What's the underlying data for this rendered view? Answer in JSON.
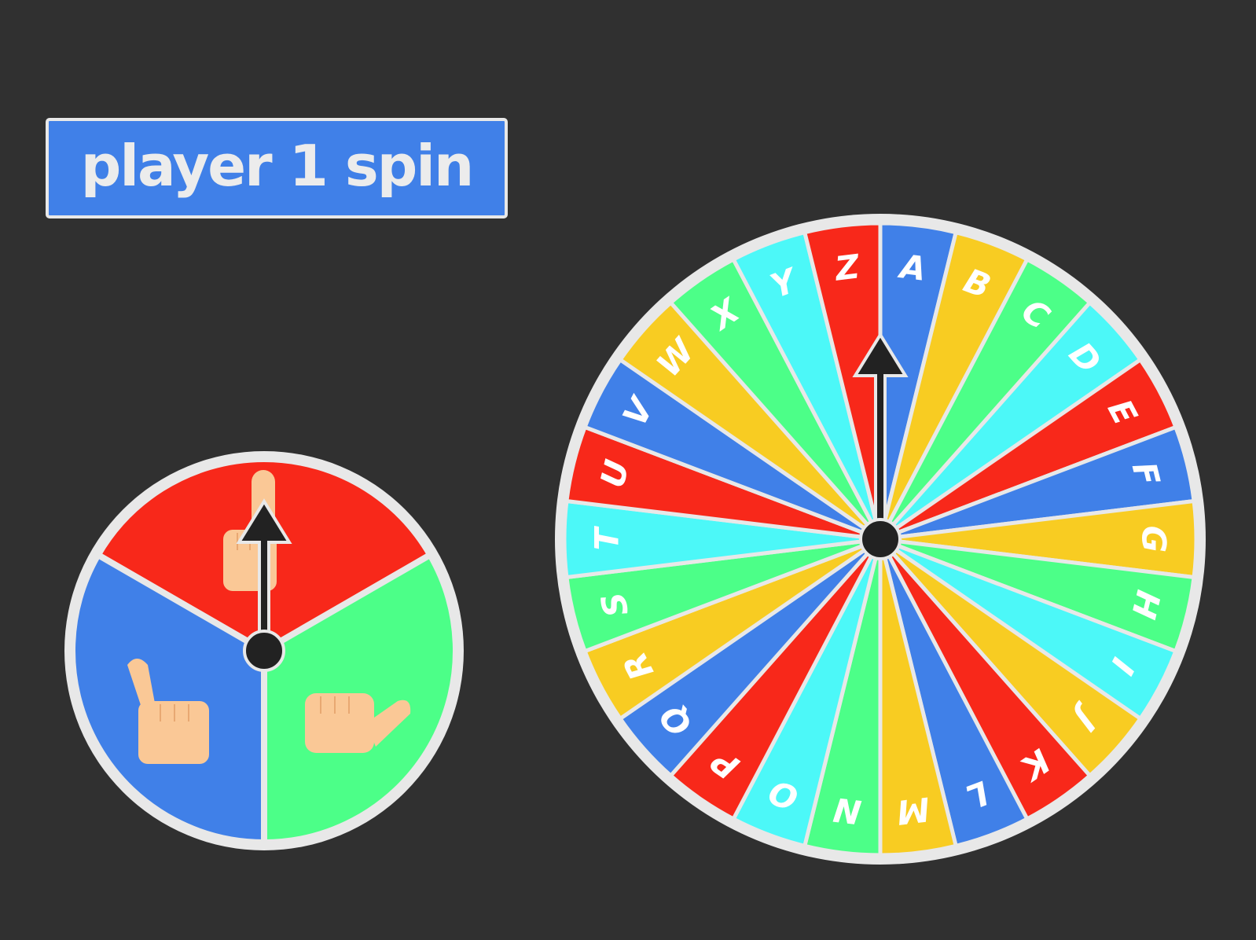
{
  "spin_button": {
    "label": "player 1 spin",
    "color": "#4080E8"
  },
  "hand_wheel": {
    "sectors": [
      {
        "icon": "middle-finger-hand-icon",
        "color": "#F8281A"
      },
      {
        "icon": "thumb-side-hand-icon",
        "color": "#4CFF88"
      },
      {
        "icon": "index-up-hand-icon",
        "color": "#4080E8"
      }
    ],
    "pointer_angle_deg": 0
  },
  "letter_wheel": {
    "sectors": [
      {
        "label": "A",
        "color": "#4080E8"
      },
      {
        "label": "B",
        "color": "#F8CC22"
      },
      {
        "label": "C",
        "color": "#4CFF88"
      },
      {
        "label": "D",
        "color": "#4CF8F8"
      },
      {
        "label": "E",
        "color": "#F8281A"
      },
      {
        "label": "F",
        "color": "#4080E8"
      },
      {
        "label": "G",
        "color": "#F8CC22"
      },
      {
        "label": "H",
        "color": "#4CFF88"
      },
      {
        "label": "I",
        "color": "#4CF8F8"
      },
      {
        "label": "J",
        "color": "#F8CC22"
      },
      {
        "label": "K",
        "color": "#F8281A"
      },
      {
        "label": "L",
        "color": "#4080E8"
      },
      {
        "label": "M",
        "color": "#F8CC22"
      },
      {
        "label": "N",
        "color": "#4CFF88"
      },
      {
        "label": "O",
        "color": "#4CF8F8"
      },
      {
        "label": "P",
        "color": "#F8281A"
      },
      {
        "label": "Q",
        "color": "#4080E8"
      },
      {
        "label": "R",
        "color": "#F8CC22"
      },
      {
        "label": "S",
        "color": "#4CFF88"
      },
      {
        "label": "T",
        "color": "#4CF8F8"
      },
      {
        "label": "U",
        "color": "#F8281A"
      },
      {
        "label": "V",
        "color": "#4080E8"
      },
      {
        "label": "W",
        "color": "#F8CC22"
      },
      {
        "label": "X",
        "color": "#4CFF88"
      },
      {
        "label": "Y",
        "color": "#4CF8F8"
      },
      {
        "label": "Z",
        "color": "#F8281A"
      }
    ],
    "pointer_angle_deg": 0
  },
  "colors": {
    "background": "#303030",
    "outline": "#E8E8E8",
    "pointer": "#222222",
    "skin": "#FAC896"
  }
}
